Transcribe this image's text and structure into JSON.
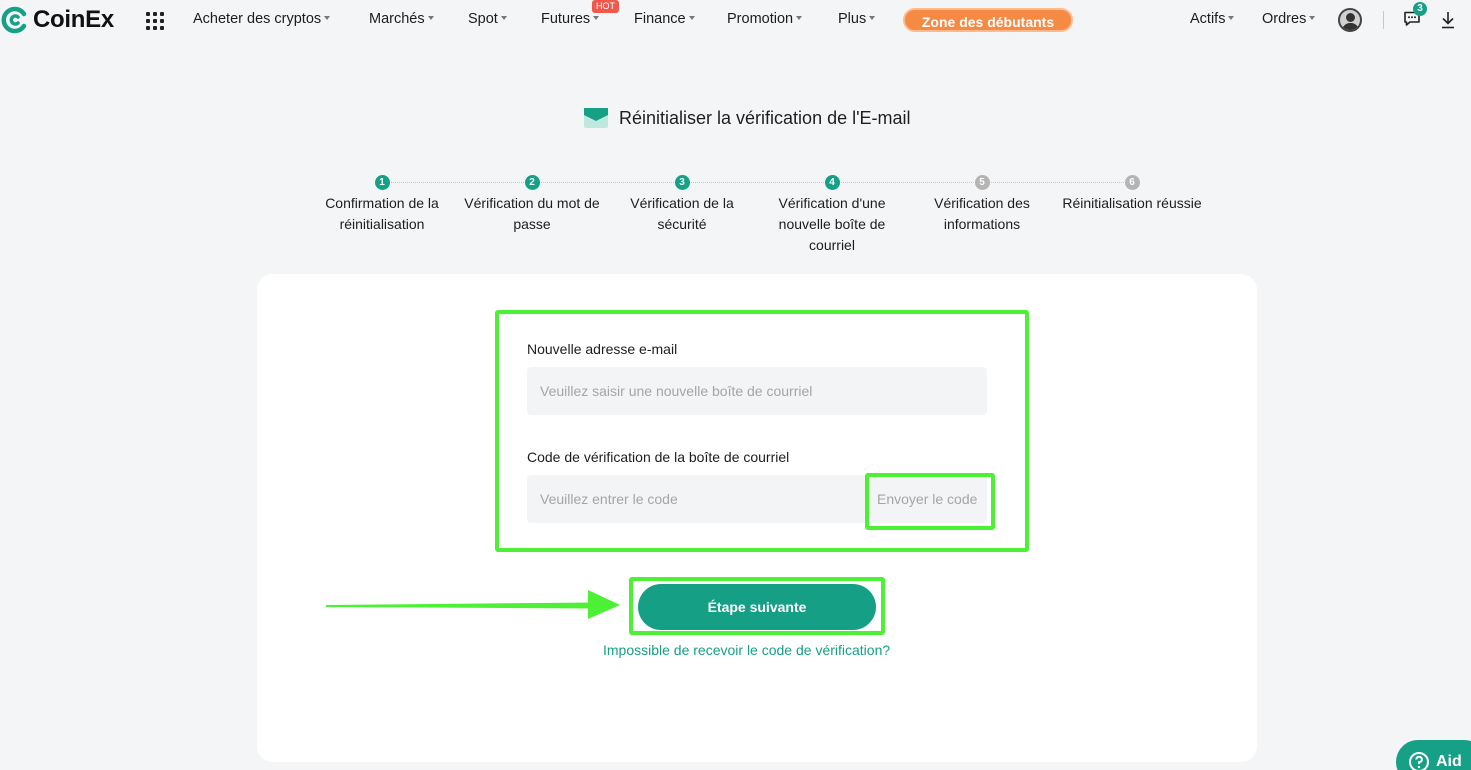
{
  "brand": {
    "name": "CoinEx",
    "accent": "#16a085",
    "highlight": "#4cf034"
  },
  "nav": {
    "items": [
      {
        "label": "Acheter des cryptos"
      },
      {
        "label": "Marchés"
      },
      {
        "label": "Spot"
      },
      {
        "label": "Futures"
      },
      {
        "label": "Finance"
      },
      {
        "label": "Promotion"
      },
      {
        "label": "Plus"
      }
    ],
    "hot_badge": "HOT",
    "zone_button": "Zone des débutants",
    "right": {
      "assets": "Actifs",
      "orders": "Ordres",
      "message_count": "3"
    }
  },
  "page": {
    "title": "Réinitialiser la vérification de l'E-mail",
    "steps": [
      {
        "num": "1",
        "label": "Confirmation de la réinitialisation",
        "status": "done"
      },
      {
        "num": "2",
        "label": "Vérification du mot de passe",
        "status": "done"
      },
      {
        "num": "3",
        "label": "Vérification de la sécurité",
        "status": "done"
      },
      {
        "num": "4",
        "label": "Vérification d'une nouvelle boîte de courriel",
        "status": "current"
      },
      {
        "num": "5",
        "label": "Vérification des informations",
        "status": "pending"
      },
      {
        "num": "6",
        "label": "Réinitialisation réussie",
        "status": "pending"
      }
    ]
  },
  "form": {
    "email_label": "Nouvelle adresse e-mail",
    "email_placeholder": "Veuillez saisir une nouvelle boîte de courriel",
    "code_label": "Code de vérification de la boîte de courriel",
    "code_placeholder": "Veuillez entrer le code",
    "send_code": "Envoyer le code",
    "next_button": "Étape suivante",
    "help_link": "Impossible de recevoir le code de vérification?"
  },
  "help_button": "Aid"
}
